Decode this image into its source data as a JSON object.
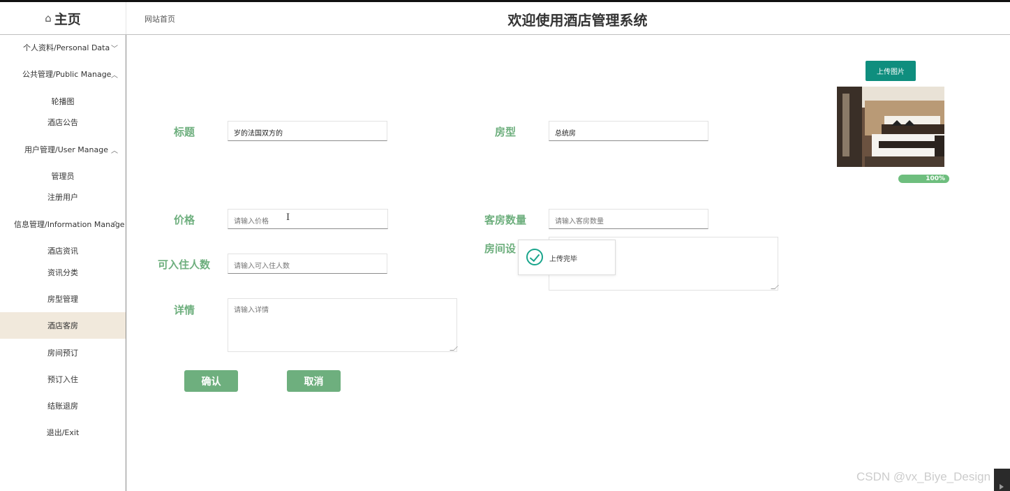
{
  "header": {
    "logo": "主页",
    "breadcrumb": "网站首页",
    "system_title": "欢迎使用酒店管理系统"
  },
  "sidebar": {
    "groups": [
      {
        "label": "个人资料/Personal Data",
        "chevron": "﹀"
      },
      {
        "label": "公共管理/Public Manage",
        "chevron": "︿"
      },
      {
        "label": "用户管理/User Manage",
        "chevron": "︿"
      },
      {
        "label": "信息管理/Information Manage",
        "chevron": "^"
      }
    ],
    "items": [
      {
        "label": "轮播图"
      },
      {
        "label": "酒店公告"
      },
      {
        "label": "管理员"
      },
      {
        "label": "注册用户"
      },
      {
        "label": "酒店资讯"
      },
      {
        "label": "资讯分类"
      },
      {
        "label": "房型管理"
      },
      {
        "label": "酒店客房",
        "active": true
      },
      {
        "label": "房间预订"
      },
      {
        "label": "预订入住"
      },
      {
        "label": "结账退房"
      },
      {
        "label": "退出/Exit"
      }
    ],
    "active_color": "#f1e9dc"
  },
  "form": {
    "title": {
      "label": "标题",
      "value": "岁的法国双方的"
    },
    "room_type": {
      "label": "房型",
      "value": "总统房"
    },
    "price": {
      "label": "价格",
      "placeholder": "请输入价格"
    },
    "room_count": {
      "label": "客房数量",
      "placeholder": "请输入客房数量"
    },
    "capacity": {
      "label": "可入住人数",
      "placeholder": "请输入可入住人数"
    },
    "facilities": {
      "label": "房间设"
    },
    "details": {
      "label": "详情",
      "placeholder": "请输入详情"
    },
    "confirm_label": "确认",
    "cancel_label": "取消",
    "label_color": "#6eaf7e"
  },
  "upload": {
    "button_label": "上传图片",
    "progress_percent": 100,
    "progress_text": "100%",
    "button_color": "#0f8e7e"
  },
  "toast": {
    "message": "上传完毕",
    "icon": "check-circle-icon"
  },
  "watermark": "CSDN @vx_Biye_Design"
}
